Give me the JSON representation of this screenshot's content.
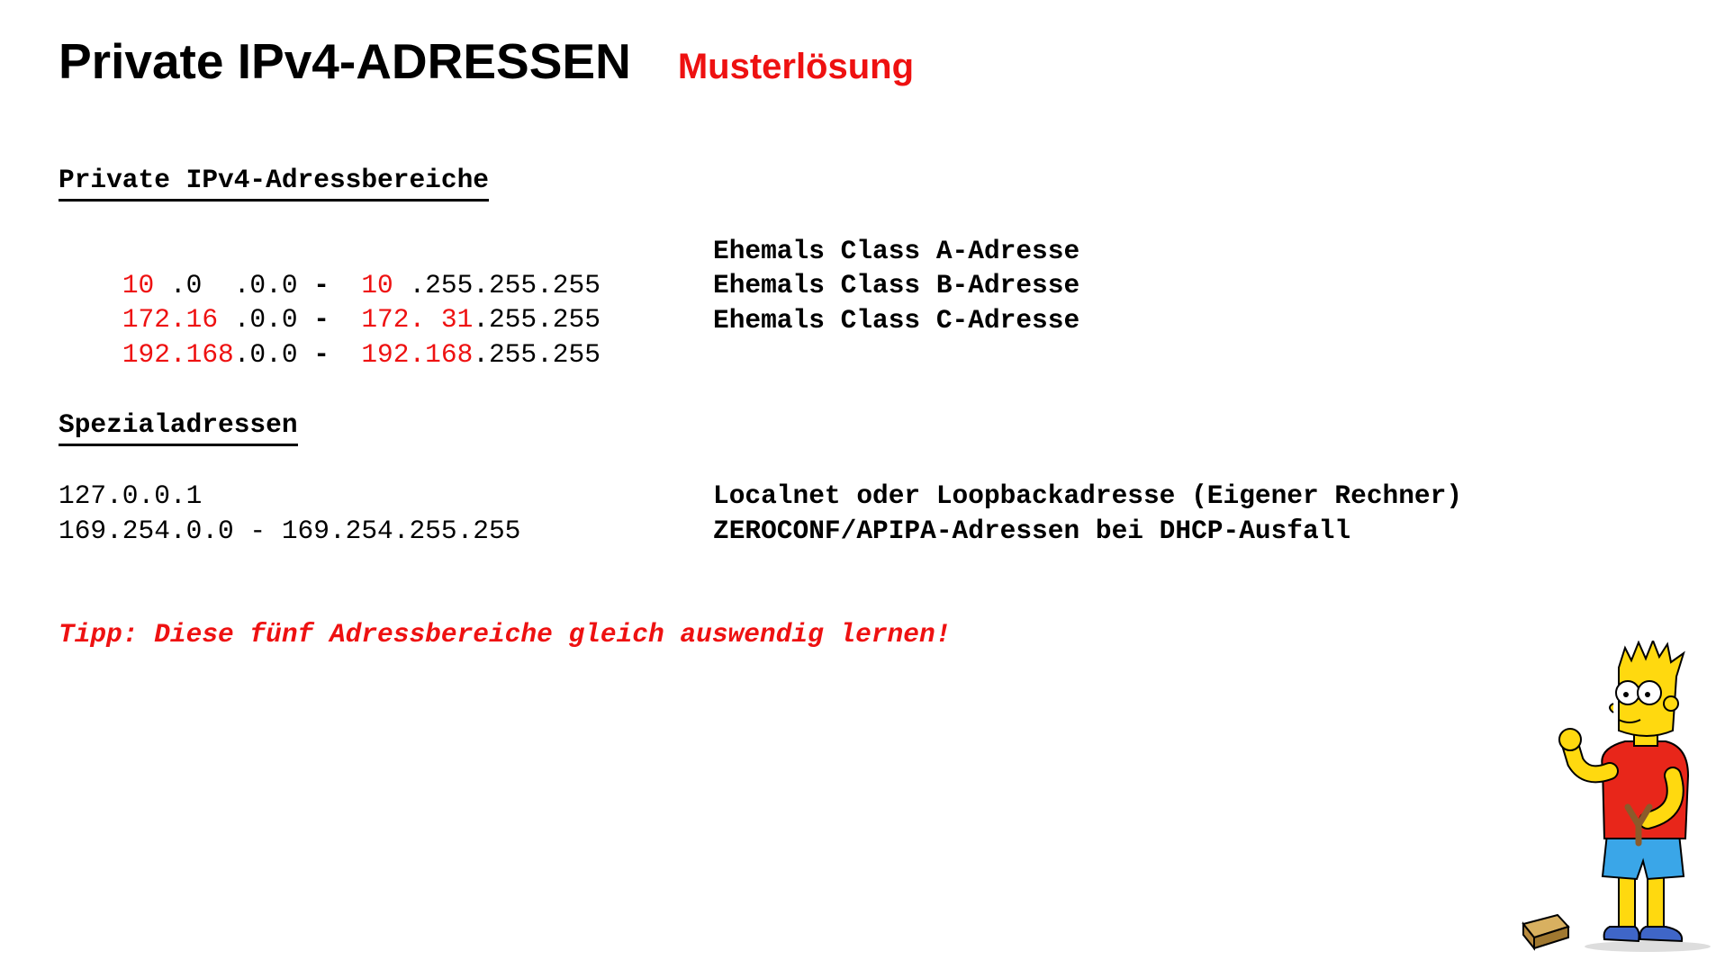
{
  "header": {
    "title": "Private IPv4-ADRESSEN",
    "subtitle": "Musterlösung"
  },
  "private_ranges": {
    "heading": "Private IPv4-Adressbereiche",
    "rows": [
      {
        "start_net": "10",
        "start_rest": " .0  .0.0",
        "dash": " - ",
        "end_net": "10",
        "end_rest": " .255.255.255",
        "description": "Ehemals Class A-Adresse"
      },
      {
        "start_net": "172.16",
        "start_rest": " .0.0",
        "dash": " - ",
        "end_net": "172. 31",
        "end_rest": ".255.255",
        "description": "Ehemals Class B-Adresse"
      },
      {
        "start_net": "192.168",
        "start_rest": ".0.0",
        "dash": " - ",
        "end_net": "192.168",
        "end_rest": ".255.255",
        "description": "Ehemals Class C-Adresse"
      }
    ]
  },
  "special": {
    "heading": "Spezialadressen",
    "rows": [
      {
        "address": "127.0.0.1",
        "description": "Localnet oder Loopbackadresse (Eigener Rechner)"
      },
      {
        "address": "169.254.0.0 - 169.254.255.255",
        "description": "ZEROCONF/APIPA-Adressen bei DHCP-Ausfall"
      }
    ]
  },
  "tip": "Tipp: Diese fünf Adressbereiche gleich auswendig lernen!",
  "colors": {
    "accent_red": "#ee1111",
    "text": "#000000",
    "background": "#ffffff"
  },
  "illustration": "cartoon-boy-with-slingshot"
}
